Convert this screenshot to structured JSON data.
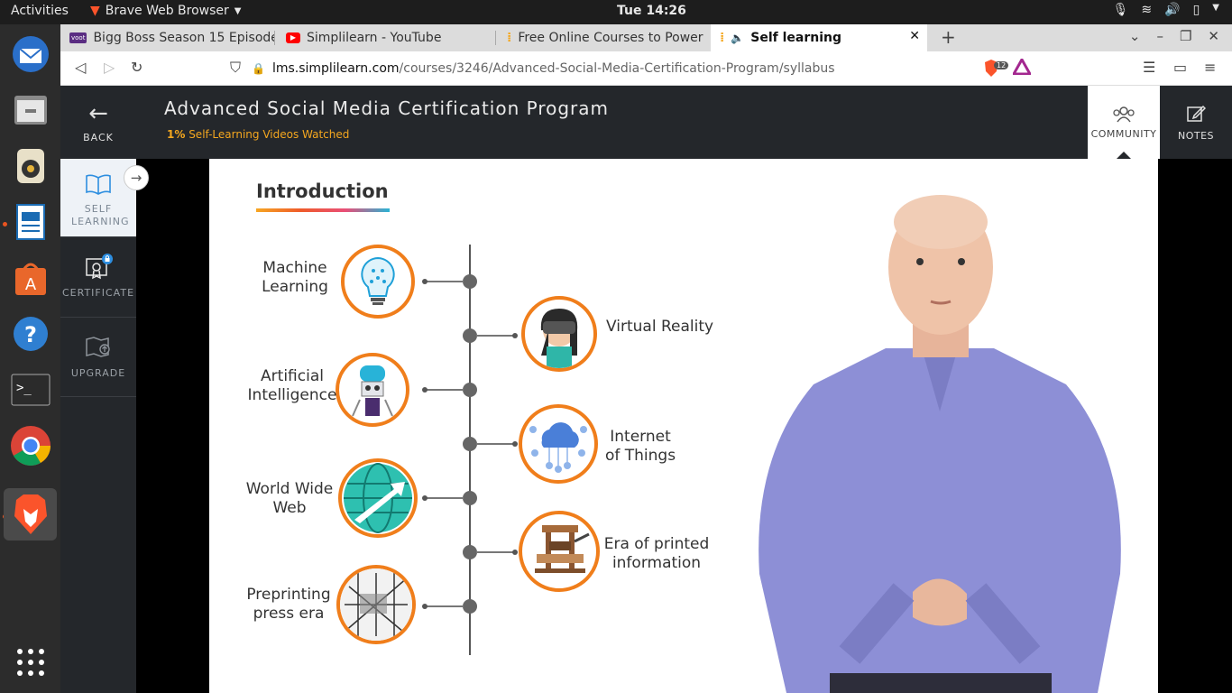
{
  "system_bar": {
    "activities": "Activities",
    "app_name": "Brave Web Browser",
    "clock": "Tue 14:26"
  },
  "browser": {
    "tabs": [
      {
        "label": "Bigg Boss Season 15 Episode",
        "icon": "voot-icon"
      },
      {
        "label": "Simplilearn - YouTube",
        "icon": "youtube-icon"
      },
      {
        "label": "Free Online Courses to Power",
        "icon": "simplilearn-icon"
      },
      {
        "label": "Self learning",
        "icon": "simplilearn-icon",
        "active": true
      }
    ],
    "url_host": "lms.simplilearn.com",
    "url_path": "/courses/3246/Advanced-Social-Media-Certification-Program/syllabus",
    "shield_count": "12"
  },
  "header": {
    "back_label": "BACK",
    "course_title": "Advanced Social Media Certification Program",
    "progress_percent": "1%",
    "progress_text": " Self-Learning Videos Watched",
    "community_label": "COMMUNITY",
    "notes_label": "NOTES"
  },
  "sidebar": {
    "items": [
      {
        "label": "SELF LEARNING"
      },
      {
        "label": "CERTIFICATE"
      },
      {
        "label": "UPGRADE"
      }
    ]
  },
  "slide": {
    "title": "Introduction",
    "left_items": [
      {
        "label": "Machine\nLearning"
      },
      {
        "label": "Artificial\nIntelligence"
      },
      {
        "label": "World Wide\nWeb"
      },
      {
        "label": "Preprinting\npress era"
      }
    ],
    "right_items": [
      {
        "label": "Virtual Reality"
      },
      {
        "label": "Internet\nof Things"
      },
      {
        "label": "Era of printed\ninformation"
      }
    ]
  },
  "colors": {
    "accent_orange": "#f07e1b",
    "progress_yellow": "#f4a71f",
    "header_dark": "#24272b"
  }
}
